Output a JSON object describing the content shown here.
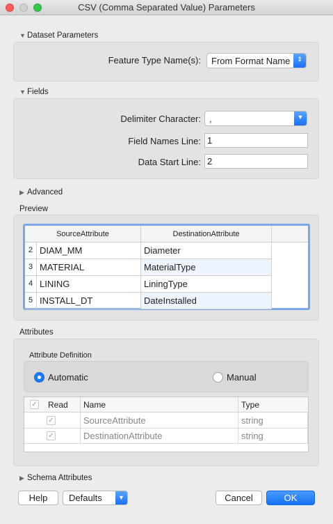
{
  "window": {
    "title": "CSV (Comma Separated Value) Parameters"
  },
  "dataset": {
    "header": "Dataset Parameters",
    "feature_type_label": "Feature Type Name(s):",
    "feature_type_value": "From Format Name"
  },
  "fields": {
    "header": "Fields",
    "delimiter_label": "Delimiter Character:",
    "delimiter_value": ",",
    "field_names_label": "Field Names Line:",
    "field_names_value": "1",
    "data_start_label": "Data Start Line:",
    "data_start_value": "2"
  },
  "advanced": {
    "header": "Advanced"
  },
  "preview": {
    "header": "Preview",
    "columns": [
      "SourceAttribute",
      "DestinationAttribute"
    ],
    "rows": [
      {
        "num": "2",
        "source": "DIAM_MM",
        "dest": "Diameter"
      },
      {
        "num": "3",
        "source": "MATERIAL",
        "dest": "MaterialType"
      },
      {
        "num": "4",
        "source": "LINING",
        "dest": "LiningType"
      },
      {
        "num": "5",
        "source": "INSTALL_DT",
        "dest": "DateInstalled"
      }
    ]
  },
  "attributes": {
    "header": "Attributes",
    "definition_label": "Attribute Definition",
    "automatic": "Automatic",
    "manual": "Manual",
    "columns": {
      "read": "Read",
      "name": "Name",
      "type": "Type"
    },
    "rows": [
      {
        "name": "SourceAttribute",
        "type": "string"
      },
      {
        "name": "DestinationAttribute",
        "type": "string"
      }
    ]
  },
  "schema": {
    "header": "Schema Attributes"
  },
  "buttons": {
    "help": "Help",
    "defaults": "Defaults",
    "cancel": "Cancel",
    "ok": "OK"
  }
}
